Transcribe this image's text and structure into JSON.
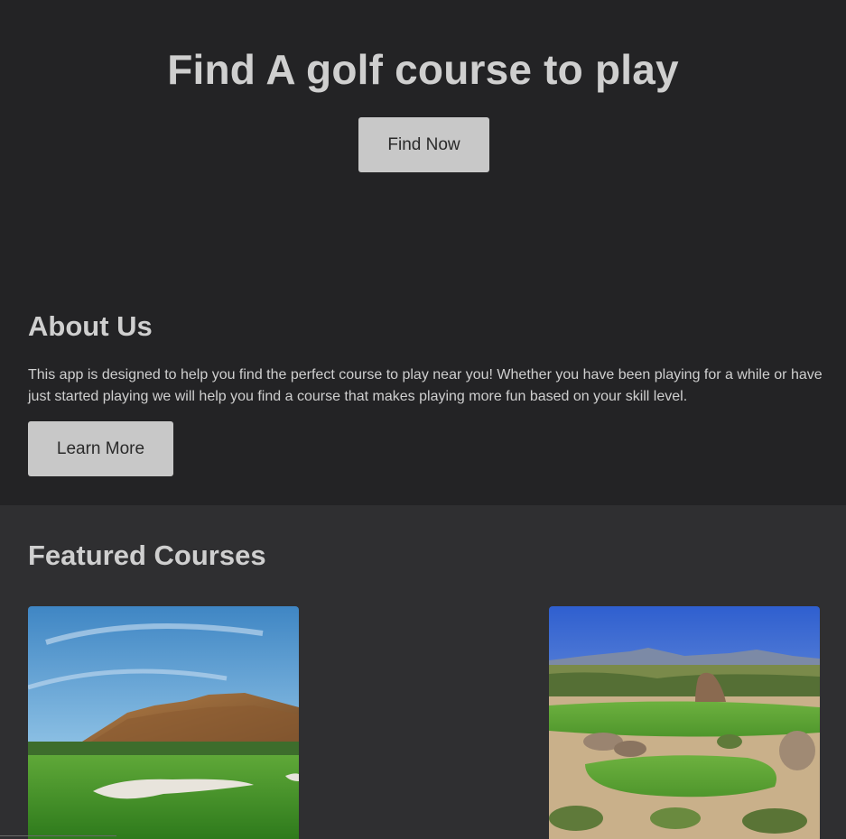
{
  "hero": {
    "title": "Find A golf course to play",
    "button_label": "Find Now"
  },
  "about": {
    "title": "About Us",
    "text": "This app is designed to help you find the perfect course to play near you! Whether you have been playing for a while or have just started playing we will help you find a course that makes playing more fun based on your skill level.",
    "button_label": "Learn More"
  },
  "featured": {
    "title": "Featured Courses",
    "courses": [
      {
        "image": "golf-course-mountain-photo"
      },
      {
        "image": "golf-course-desert-photo"
      }
    ]
  },
  "colors": {
    "background": "#232325",
    "featured_background": "#2f2f31",
    "text": "#cfcfcf",
    "button": "#c8c8c8",
    "button_text": "#2a2a2a"
  }
}
